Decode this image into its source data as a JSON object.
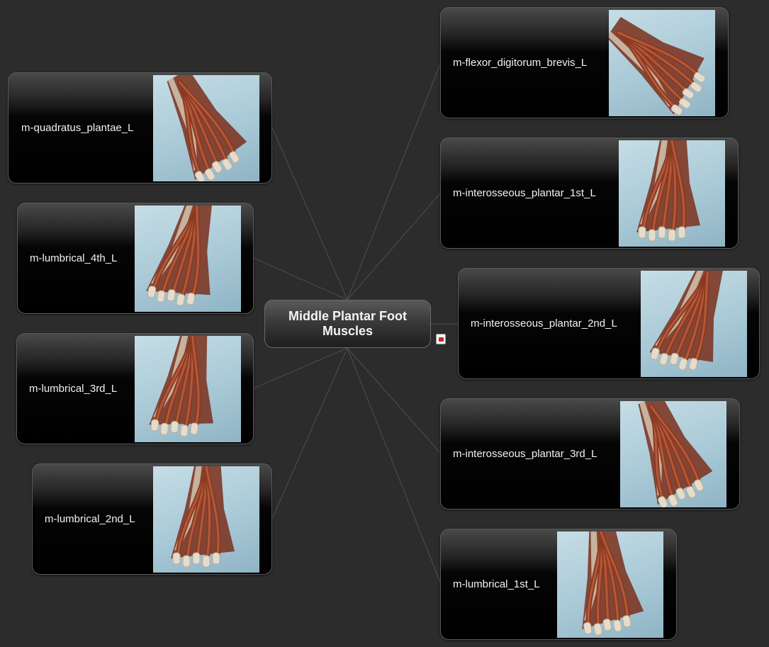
{
  "map": {
    "central_topic": "Middle Plantar Foot Muscles",
    "line_color": "#4a4a4a",
    "left_topics": [
      {
        "label": "m-quadratus_plantae_L",
        "image": "foot-muscle-thumbnail"
      },
      {
        "label": "m-lumbrical_4th_L",
        "image": "foot-muscle-thumbnail"
      },
      {
        "label": "m-lumbrical_3rd_L",
        "image": "foot-muscle-thumbnail"
      },
      {
        "label": "m-lumbrical_2nd_L",
        "image": "foot-muscle-thumbnail"
      }
    ],
    "right_topics": [
      {
        "label": "m-flexor_digitorum_brevis_L",
        "image": "foot-muscle-thumbnail"
      },
      {
        "label": "m-interosseous_plantar_1st_L",
        "image": "foot-muscle-thumbnail"
      },
      {
        "label": "m-interosseous_plantar_2nd_L",
        "image": "foot-muscle-thumbnail"
      },
      {
        "label": "m-interosseous_plantar_3rd_L",
        "image": "foot-muscle-thumbnail"
      },
      {
        "label": "m-lumbrical_1st_L",
        "image": "foot-muscle-thumbnail"
      }
    ],
    "attachment_icon": "pdf-attachment-icon"
  }
}
